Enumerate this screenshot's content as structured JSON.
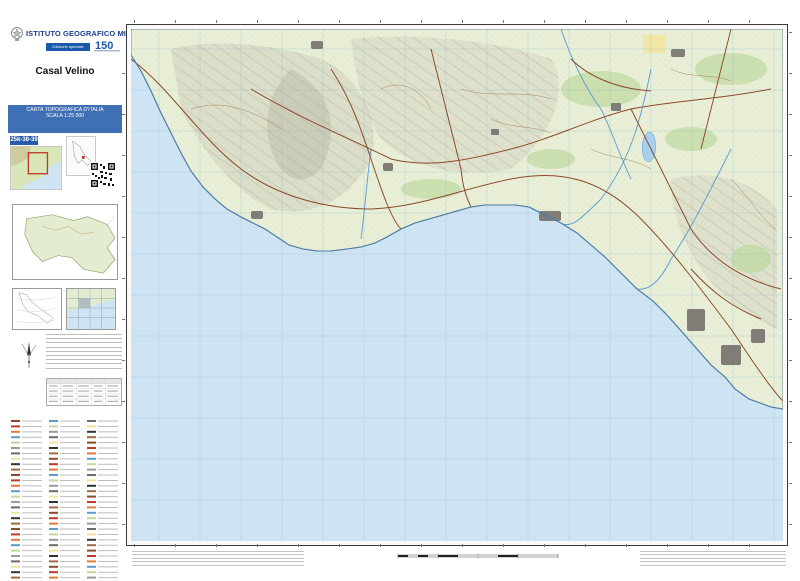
{
  "institute": {
    "name": "Istituto Geografico Militare",
    "edition_label": "Edizione speciale"
  },
  "sheet": {
    "name": "Casal Velino",
    "code": "25k-38-39"
  },
  "series": {
    "title": "CARTA TOPOGRAFICA D'ITALIA",
    "scale": "SCALA 1:25 000"
  },
  "colors": {
    "sea": "#cfe4f3",
    "land": "#e8efd6",
    "relief": "#b9b3a6",
    "roads": "#8b4a2a",
    "grid": "#7fb0cf",
    "brand_blue": "#1b3f8f"
  },
  "icons": [
    "italian-emblem-icon",
    "igm-150-logo-icon",
    "qr-code-icon",
    "north-arrow-icon",
    "compass-rose-icon"
  ]
}
